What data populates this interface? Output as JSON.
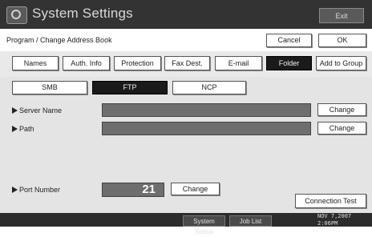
{
  "title_bar": {
    "title": "System Settings",
    "exit_label": "Exit",
    "icon": "settings-icon"
  },
  "sub_header": {
    "breadcrumb": "Program / Change Address Book",
    "cancel_label": "Cancel",
    "ok_label": "OK"
  },
  "tabs": [
    {
      "label": "Names",
      "selected": false
    },
    {
      "label": "Auth. Info",
      "selected": false
    },
    {
      "label": "Protection",
      "selected": false
    },
    {
      "label": "Fax Dest.",
      "selected": false
    },
    {
      "label": "E-mail",
      "selected": false
    },
    {
      "label": "Folder",
      "selected": true
    },
    {
      "label": "Add to Group",
      "selected": false
    }
  ],
  "protocols": [
    {
      "label": "SMB",
      "selected": false
    },
    {
      "label": "FTP",
      "selected": true
    },
    {
      "label": "NCP",
      "selected": false
    }
  ],
  "fields": {
    "server_name": {
      "label": "Server Name",
      "value": "",
      "change_label": "Change"
    },
    "path": {
      "label": "Path",
      "value": "",
      "change_label": "Change"
    },
    "port_number": {
      "label": "Port Number",
      "value": "21",
      "change_label": "Change"
    }
  },
  "connection_test_label": "Connection Test",
  "status_bar": {
    "system_status_label": "System Status",
    "job_list_label": "Job List",
    "date": "NOV   7,2007",
    "time": "2:06PM"
  },
  "colors": {
    "selected": "#1a1a1a",
    "field": "#6e6e6e",
    "title_bg": "#333333"
  }
}
